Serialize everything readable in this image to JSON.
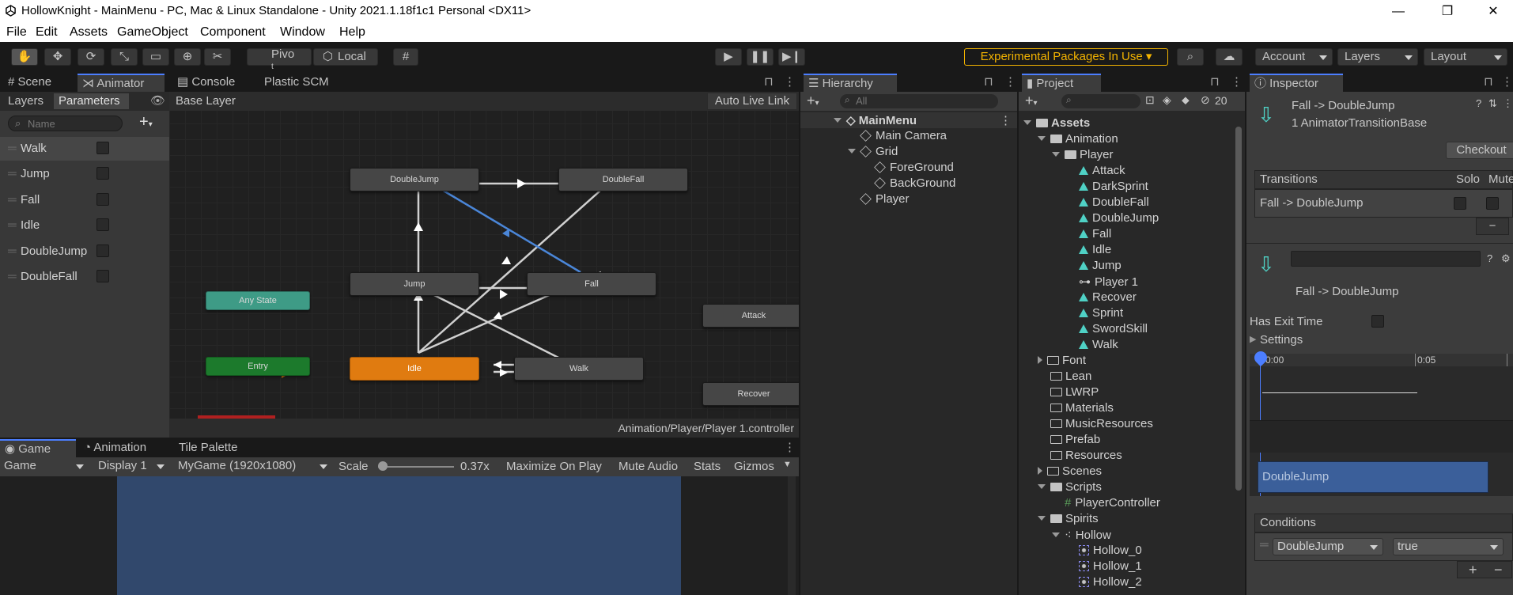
{
  "window": {
    "title": "HollowKnight - MainMenu - PC, Mac & Linux Standalone - Unity 2021.1.18f1c1 Personal <DX11>",
    "minimize": "—",
    "maximize": "❐",
    "close": "✕"
  },
  "menu": [
    "File",
    "Edit",
    "Assets",
    "GameObject",
    "Component",
    "Window",
    "Help"
  ],
  "toolbar": {
    "pivot": "Pivo",
    "pivot_sub": "t",
    "local": "Local",
    "experimental": "Experimental Packages In Use",
    "account": "Account",
    "layers": "Layers",
    "layout": "Layout",
    "accent": "#f4b400"
  },
  "animator_tabs": [
    "Scene",
    "Animator",
    "Console",
    "Plastic SCM"
  ],
  "animator": {
    "subtabs": [
      "Layers",
      "Parameters"
    ],
    "search_placeholder": "Name",
    "parameters": [
      "Walk",
      "Jump",
      "Fall",
      "Idle",
      "DoubleJump",
      "DoubleFall"
    ],
    "breadcrumb": "Base Layer",
    "auto_live_link": "Auto Live Link",
    "footer_path": "Animation/Player/Player 1.controller",
    "nodes": {
      "doublejump": "DoubleJump",
      "doublefall": "DoubleFall",
      "jump": "Jump",
      "fall": "Fall",
      "anystate": "Any State",
      "entry": "Entry",
      "idle": "Idle",
      "walk": "Walk",
      "attack": "Attack",
      "recover": "Recover"
    }
  },
  "game_tabs": [
    "Game",
    "Animation",
    "Tile Palette"
  ],
  "game": {
    "display_mode": "Game",
    "display": "Display 1",
    "resolution": "MyGame (1920x1080)",
    "scale_label": "Scale",
    "scale_value": "0.37x",
    "maximize": "Maximize On Play",
    "mute": "Mute Audio",
    "stats": "Stats",
    "gizmos": "Gizmos"
  },
  "hierarchy": {
    "tab": "Hierarchy",
    "search_placeholder": "All",
    "scene": "MainMenu",
    "items": [
      "Main Camera",
      "Grid",
      "ForeGround",
      "BackGround",
      "Player"
    ]
  },
  "project": {
    "tab": "Project",
    "hidden_count": "20",
    "root": "Assets",
    "animation_folder": "Animation",
    "player_folder": "Player",
    "clips": [
      "Attack",
      "DarkSprint",
      "DoubleFall",
      "DoubleJump",
      "Fall",
      "Idle",
      "Jump"
    ],
    "controller": "Player 1",
    "clips2": [
      "Recover",
      "Sprint",
      "SwordSkill",
      "Walk"
    ],
    "folders": [
      "Font",
      "Lean",
      "LWRP",
      "Materials",
      "MusicResources",
      "Prefab",
      "Resources",
      "Scenes",
      "Scripts"
    ],
    "script": "PlayerController",
    "spirits": "Spirits",
    "hollow": "Hollow",
    "hollow_sprites": [
      "Hollow_0",
      "Hollow_1",
      "Hollow_2"
    ]
  },
  "inspector": {
    "tab": "Inspector",
    "title": "Fall -> DoubleJump",
    "subtitle": "1 AnimatorTransitionBase",
    "checkout": "Checkout",
    "transitions_header": "Transitions",
    "solo": "Solo",
    "mute": "Mute",
    "transition_row": "Fall -> DoubleJump",
    "minus": "−",
    "transition_name": "Fall -> DoubleJump",
    "has_exit_time": "Has Exit Time",
    "settings": "Settings",
    "timeline_0": "0:00",
    "timeline_5": "0:05",
    "clip_bar": "DoubleJump",
    "conditions": "Conditions",
    "condition_param": "DoubleJump",
    "condition_value": "true",
    "plus": "+"
  }
}
